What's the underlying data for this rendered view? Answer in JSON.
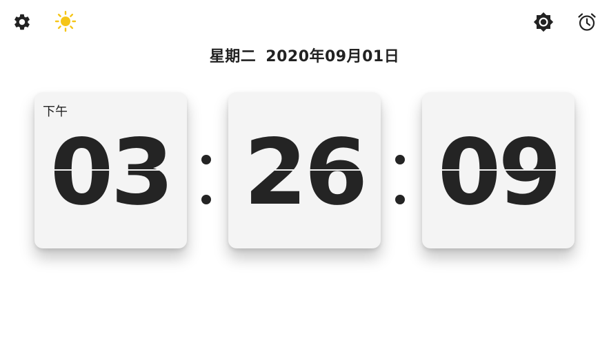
{
  "toolbar": {
    "left_icons": [
      "gear-icon",
      "sun-icon"
    ],
    "right_icons": [
      "brightness-icon",
      "alarm-clock-icon"
    ]
  },
  "date": {
    "weekday": "星期二",
    "date_text": "2020年09月01日"
  },
  "clock": {
    "ampm": "下午",
    "hours": "03",
    "minutes": "26",
    "seconds": "09",
    "separator": ":"
  },
  "colors": {
    "background": "#ffffff",
    "card": "#f4f4f4",
    "digits": "#242424",
    "sun_accent": "#f5c518"
  }
}
